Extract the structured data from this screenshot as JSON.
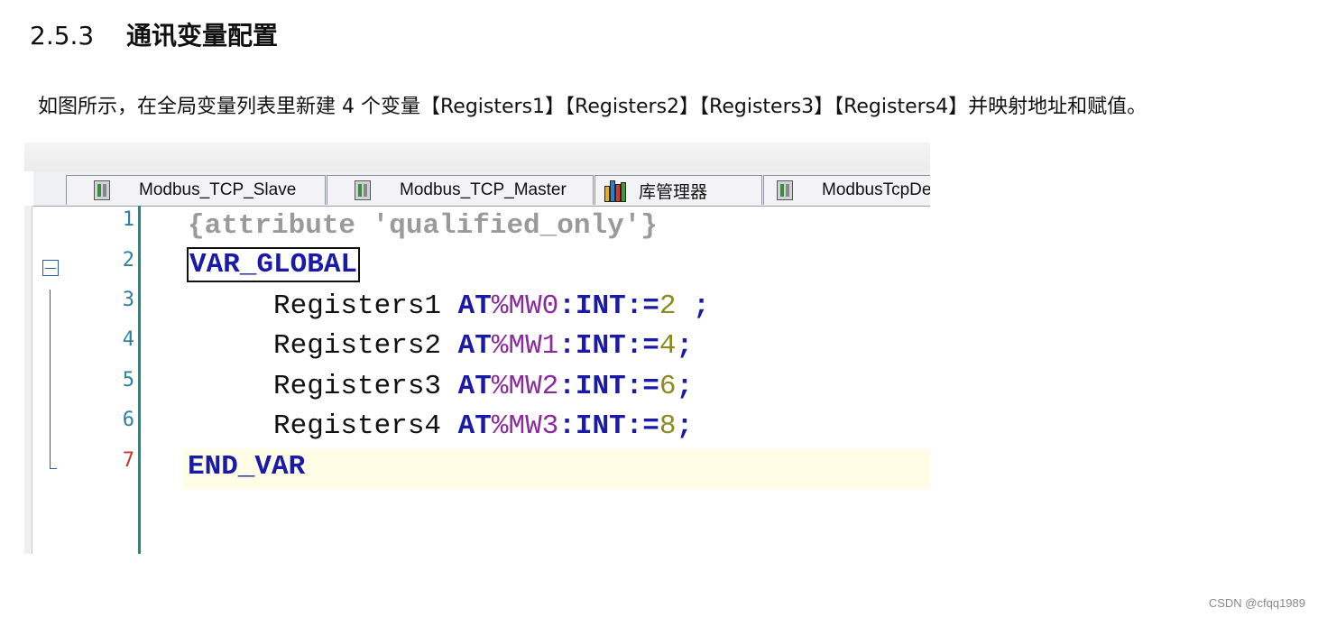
{
  "heading": {
    "number": "2.5.3",
    "title": "通讯变量配置"
  },
  "paragraph": "如图所示，在全局变量列表里新建 4 个变量【Registers1】【Registers2】【Registers3】【Registers4】并映射地址和赋值。",
  "tabs": [
    {
      "label": "Modbus_TCP_Slave",
      "icon": "device-icon"
    },
    {
      "label": "Modbus_TCP_Master",
      "icon": "device-icon"
    },
    {
      "label": "库管理器",
      "icon": "library-icon"
    },
    {
      "label": "ModbusTcpDev",
      "icon": "device-icon"
    }
  ],
  "editor": {
    "lines": [
      {
        "num": "1",
        "text": "{attribute 'qualified_only'}"
      },
      {
        "num": "2",
        "keyword": "VAR_GLOBAL"
      },
      {
        "num": "3",
        "name": "Registers1",
        "at": "AT",
        "addr": "%MW0",
        "colon1": ":",
        "type": "INT",
        "assign": ":=",
        "value": "2",
        "end": " ;"
      },
      {
        "num": "4",
        "name": "Registers2",
        "at": "AT",
        "addr": "%MW1",
        "colon1": ":",
        "type": "INT",
        "assign": ":=",
        "value": "4",
        "end": ";"
      },
      {
        "num": "5",
        "name": "Registers3",
        "at": "AT",
        "addr": "%MW2",
        "colon1": ":",
        "type": "INT",
        "assign": ":=",
        "value": "6",
        "end": ";"
      },
      {
        "num": "6",
        "name": "Registers4",
        "at": "AT",
        "addr": "%MW3",
        "colon1": ":",
        "type": "INT",
        "assign": ":=",
        "value": "8",
        "end": ";"
      },
      {
        "num": "7",
        "keyword": "END_VAR"
      }
    ]
  },
  "watermark": "CSDN @cfqq1989",
  "colors": {
    "keyword": "#1a1aa8",
    "address": "#8a2a9e",
    "number": "#8a8a1f",
    "comment": "#9a9a9a",
    "gutter": "#1d8a86",
    "current_line": "#fffde6"
  }
}
